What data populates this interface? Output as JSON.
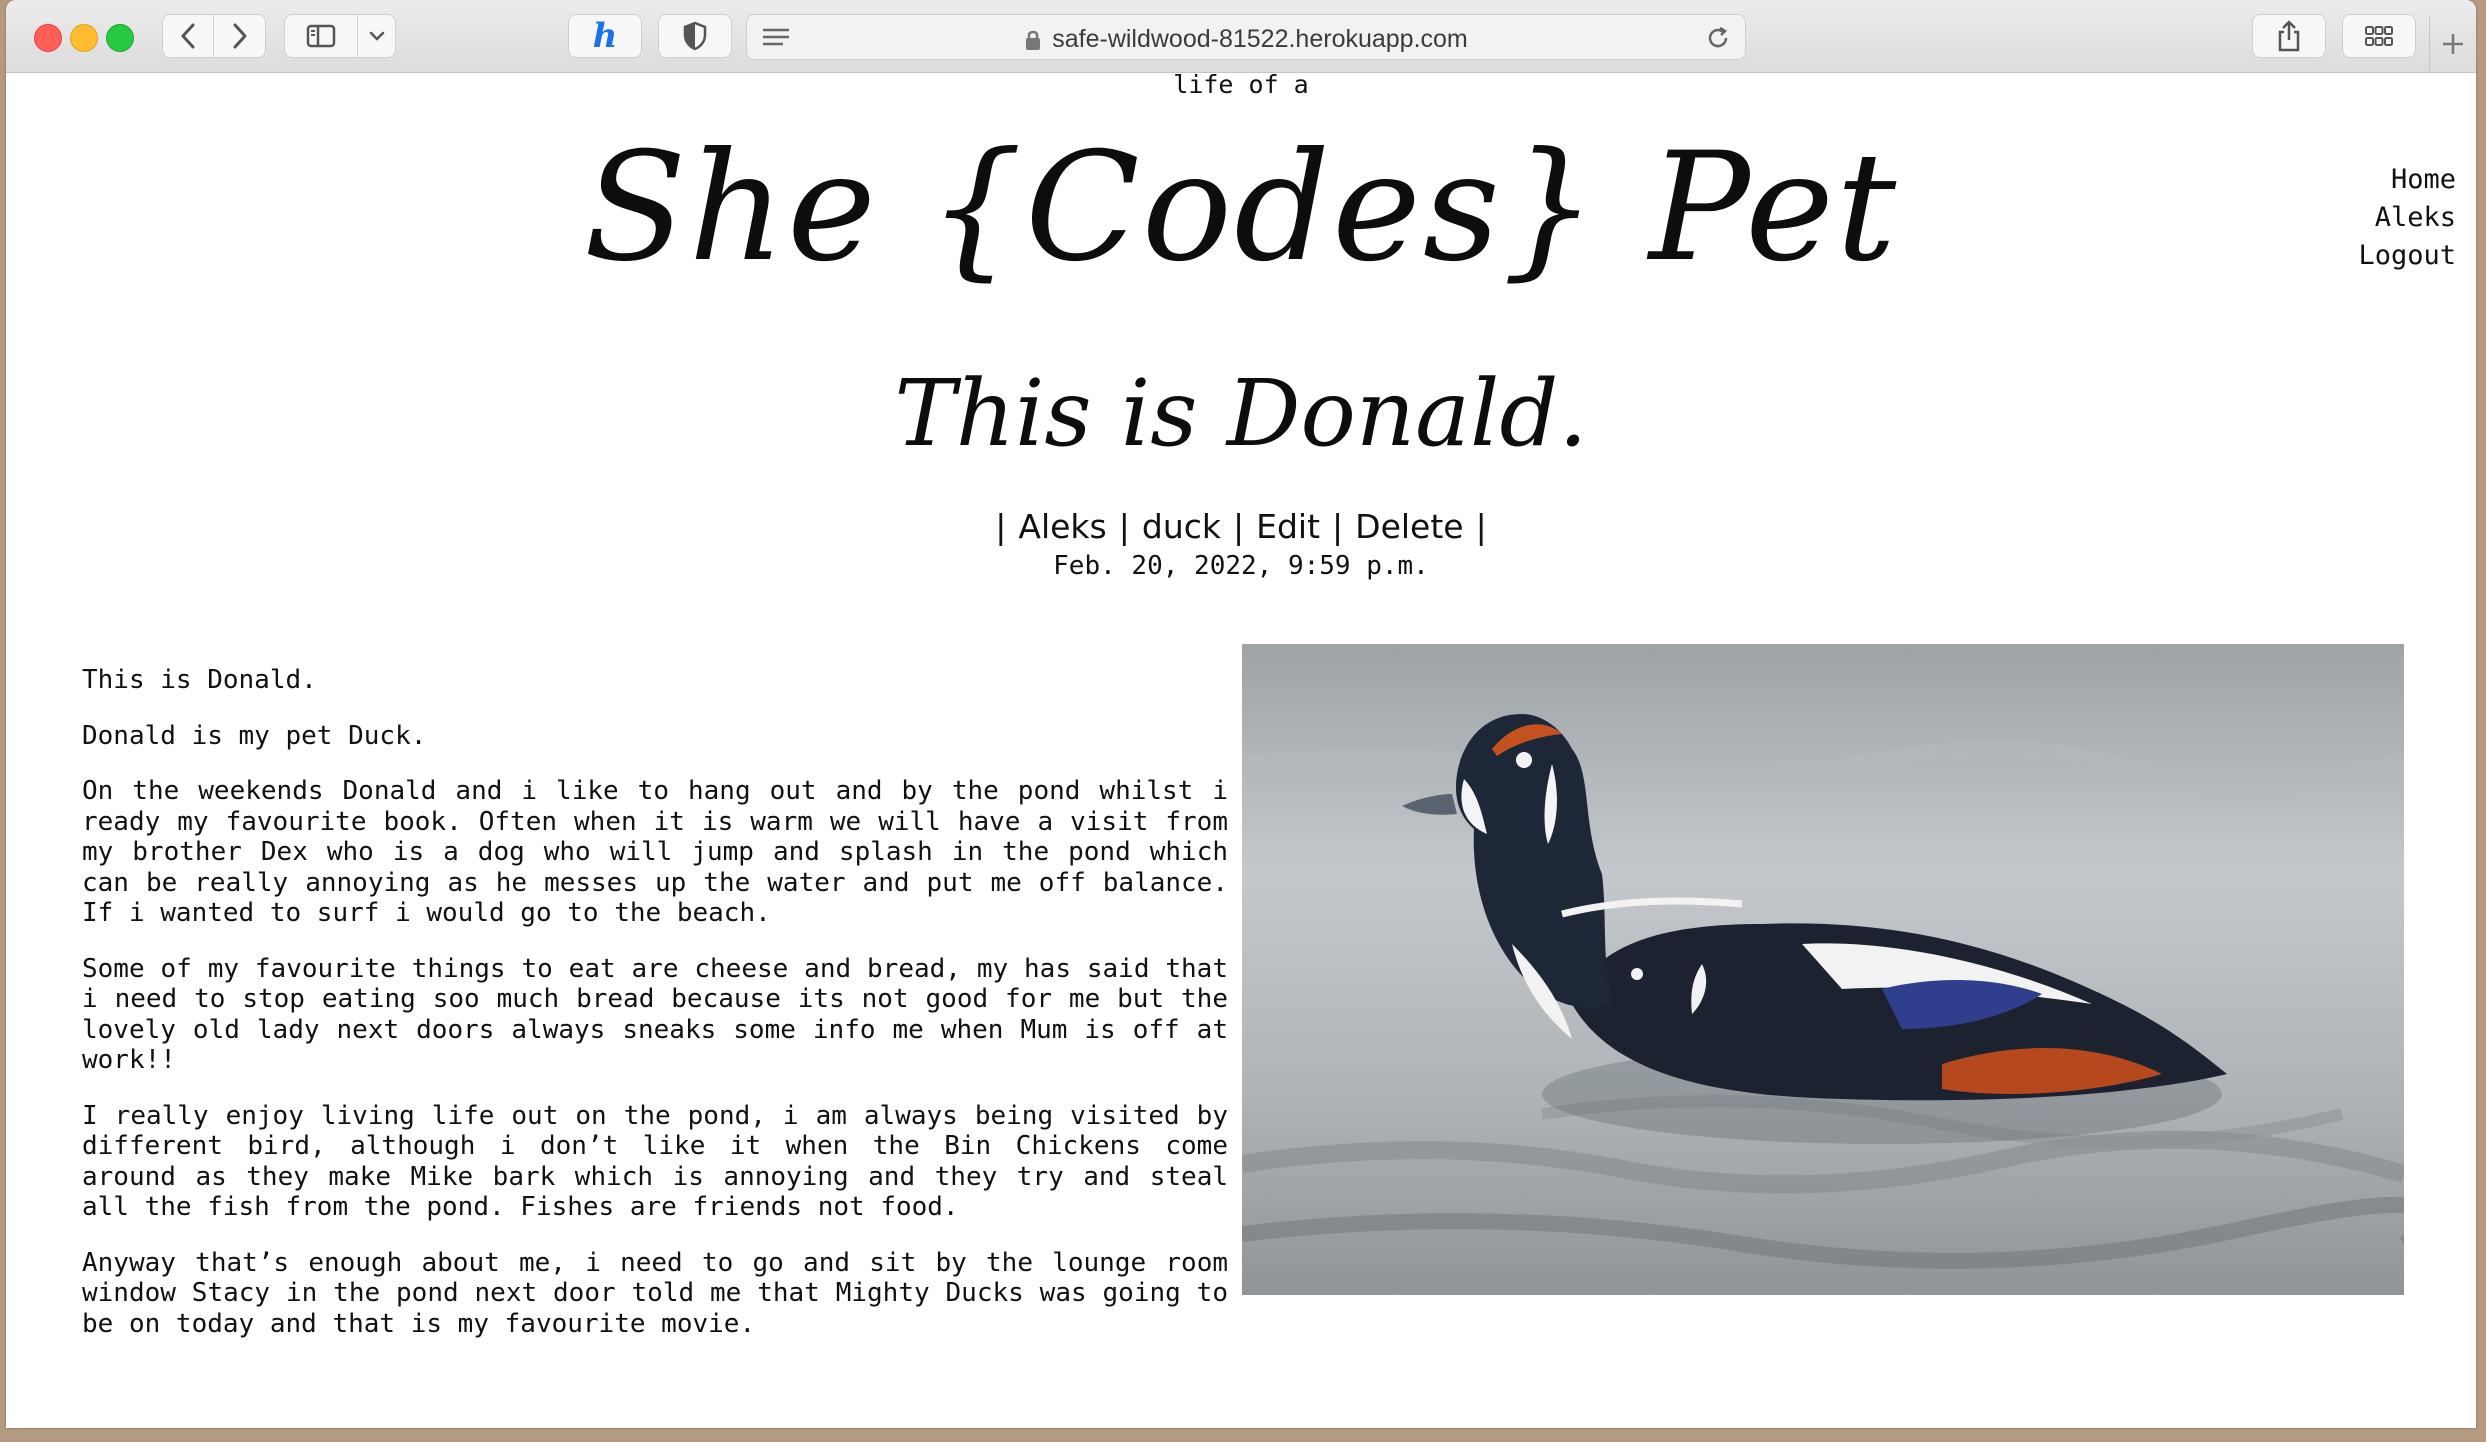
{
  "browser": {
    "url": "safe-wildwood-81522.herokuapp.com"
  },
  "site": {
    "tagline": "life of a",
    "title": "She {Codes} Pet",
    "nav": [
      "Home",
      "Aleks",
      "Logout"
    ]
  },
  "post": {
    "title": "This is Donald.",
    "author": "Aleks",
    "category": "duck",
    "edit_label": "Edit",
    "delete_label": "Delete",
    "separator": "|",
    "date": "Feb. 20, 2022, 9:59 p.m.",
    "paragraphs": [
      "This is Donald.",
      "Donald is my pet Duck.",
      "On the weekends Donald and i like to hang out and by the pond whilst i ready my favourite book. Often when it is warm we will have a visit from my brother Dex who is a dog who will jump and splash in the pond which can be really annoying as he messes up the water and put me off balance. If i wanted to surf i would go to the beach.",
      "Some of my favourite things to eat are cheese and bread, my has said that i need to stop eating soo much bread because its not good for me but the lovely old lady next doors always sneaks some info me when Mum is off at work!!",
      "I really enjoy living life out on the pond, i am always being visited by different bird, although i don’t like it when the Bin Chickens come around as they make Mike bark which is annoying and they try and steal all the fish from the pond. Fishes are friends not food.",
      "Anyway that’s enough about me, i need to go and sit by the lounge room window Stacy in the pond next door told me that Mighty Ducks was going to be on today and that is my favourite movie."
    ]
  },
  "colors": {
    "traffic_red": "#fe5f57",
    "traffic_yellow": "#febc2e",
    "traffic_green": "#28c840",
    "honey_icon": "#1a73e8"
  }
}
